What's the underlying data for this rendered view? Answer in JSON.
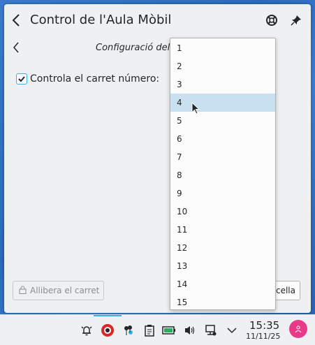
{
  "window": {
    "title": "Control de l'Aula Mòbil",
    "page_title": "Configuració del"
  },
  "form": {
    "checkbox_label": "Controla el carret número:",
    "checked": true
  },
  "buttons": {
    "release": "Allibera el carret",
    "cancel": "cella"
  },
  "dropdown": {
    "options": [
      "1",
      "2",
      "3",
      "4",
      "5",
      "6",
      "7",
      "8",
      "9",
      "10",
      "11",
      "12",
      "13",
      "14",
      "15"
    ],
    "highlighted": "4"
  },
  "taskbar": {
    "time": "15:35",
    "date": "11/11/25",
    "accent": "#3daee9"
  },
  "icons": [
    "back-arrow-icon",
    "lifebuoy-help-icon",
    "pin-icon",
    "lock-icon",
    "bell-icon",
    "record-icon",
    "balloons-icon",
    "clipboard-icon",
    "battery-icon",
    "volume-icon",
    "network-icon",
    "chevron-down-icon",
    "user-icon"
  ]
}
